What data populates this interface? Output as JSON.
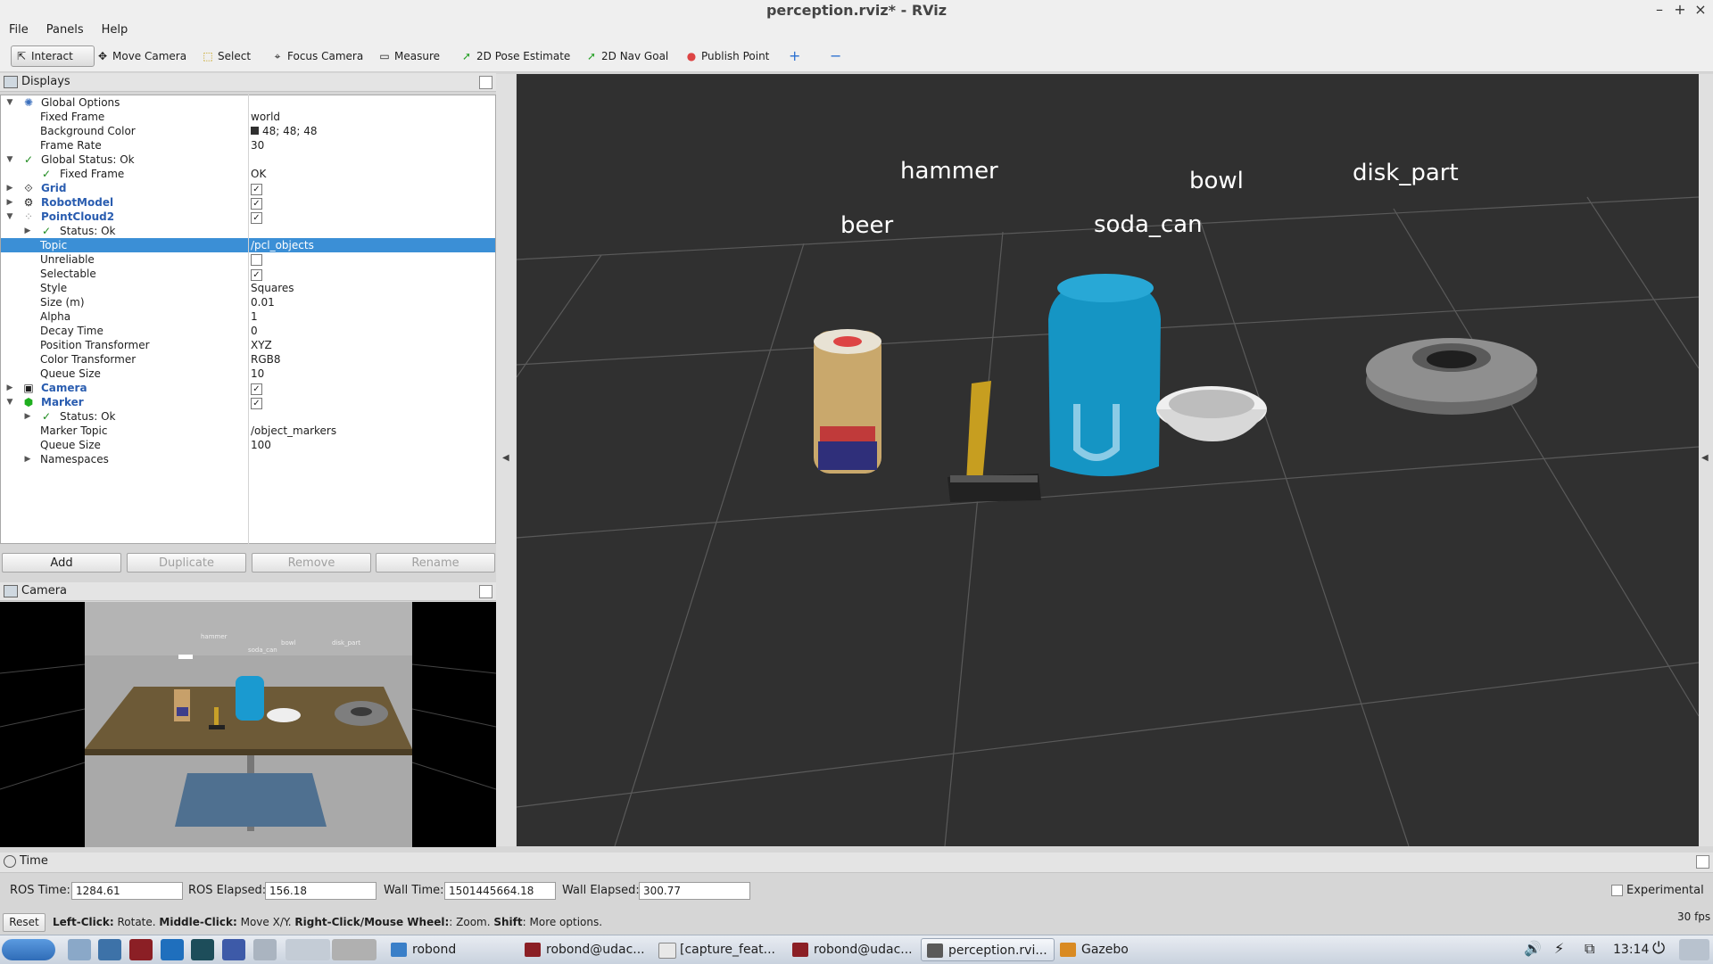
{
  "window": {
    "title": "perception.rviz* - RViz"
  },
  "menu": [
    "File",
    "Panels",
    "Help"
  ],
  "toolbar": {
    "interact": "Interact",
    "move_camera": "Move Camera",
    "select": "Select",
    "focus_camera": "Focus Camera",
    "measure": "Measure",
    "pose_estimate": "2D Pose Estimate",
    "nav_goal": "2D Nav Goal",
    "publish_point": "Publish Point"
  },
  "displays": {
    "title": "Displays",
    "rows": {
      "global_options": "Global Options",
      "fixed_frame": "Fixed Frame",
      "fixed_frame_val": "world",
      "background_color": "Background Color",
      "background_color_val": "48; 48; 48",
      "frame_rate": "Frame Rate",
      "frame_rate_val": "30",
      "global_status": "Global Status: Ok",
      "gs_fixed_frame": "Fixed Frame",
      "gs_fixed_frame_val": "OK",
      "grid": "Grid",
      "robot_model": "RobotModel",
      "pointcloud2": "PointCloud2",
      "pc_status": "Status: Ok",
      "topic": "Topic",
      "topic_val": "/pcl_objects",
      "unreliable": "Unreliable",
      "selectable": "Selectable",
      "style": "Style",
      "style_val": "Squares",
      "size": "Size (m)",
      "size_val": "0.01",
      "alpha": "Alpha",
      "alpha_val": "1",
      "decay": "Decay Time",
      "decay_val": "0",
      "pos_tf": "Position Transformer",
      "pos_tf_val": "XYZ",
      "color_tf": "Color Transformer",
      "color_tf_val": "RGB8",
      "queue": "Queue Size",
      "queue_val": "10",
      "camera": "Camera",
      "marker": "Marker",
      "marker_status": "Status: Ok",
      "marker_topic": "Marker Topic",
      "marker_topic_val": "/object_markers",
      "marker_queue": "Queue Size",
      "marker_queue_val": "100",
      "namespaces": "Namespaces"
    },
    "buttons": {
      "add": "Add",
      "duplicate": "Duplicate",
      "remove": "Remove",
      "rename": "Rename"
    }
  },
  "camera_panel": {
    "title": "Camera",
    "labels": [
      "hammer",
      "bowl",
      "soda_can",
      "disk_part"
    ]
  },
  "viewport": {
    "labels": {
      "hammer": "hammer",
      "bowl": "bowl",
      "disk_part": "disk_part",
      "beer": "beer",
      "soda_can": "soda_can"
    }
  },
  "time": {
    "title": "Time",
    "ros_time_label": "ROS Time:",
    "ros_time": "1284.61",
    "ros_elapsed_label": "ROS Elapsed:",
    "ros_elapsed": "156.18",
    "wall_time_label": "Wall Time:",
    "wall_time": "1501445664.18",
    "wall_elapsed_label": "Wall Elapsed:",
    "wall_elapsed": "300.77",
    "experimental": "Experimental"
  },
  "status": {
    "reset": "Reset",
    "hint_b1": "Left-Click:",
    "hint_t1": " Rotate. ",
    "hint_b2": "Middle-Click:",
    "hint_t2": " Move X/Y. ",
    "hint_b3": "Right-Click/Mouse Wheel:",
    "hint_t3": ": Zoom. ",
    "hint_b4": "Shift",
    "hint_t4": ": More options.",
    "fps": "30 fps"
  },
  "taskbar": {
    "tasks": [
      "robond",
      "robond@udac...",
      "[capture_feat...",
      "robond@udac...",
      "perception.rvi...",
      "Gazebo"
    ],
    "clock": "13:14"
  }
}
